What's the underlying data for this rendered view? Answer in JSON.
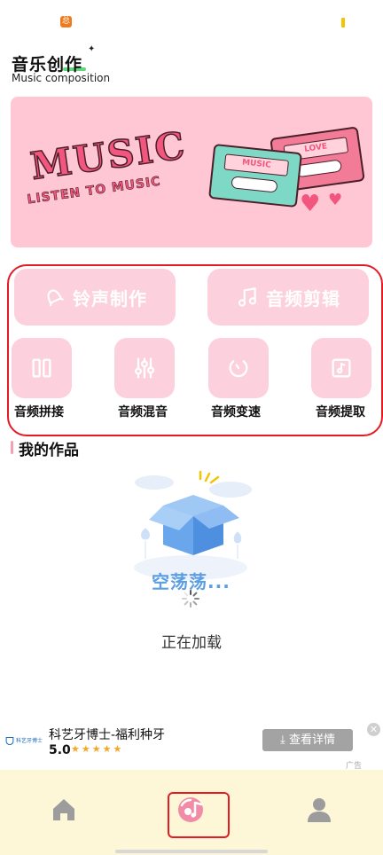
{
  "status_bar": {
    "app_icon_label": "总"
  },
  "header": {
    "title": "音乐创作",
    "subtitle": "Music composition"
  },
  "banner": {
    "headline": "MUSIC",
    "tagline": "LISTEN TO MUSIC",
    "cassette_front_label": "MUSIC",
    "cassette_back_label": "LOVE"
  },
  "features": {
    "ringtone": "铃声制作",
    "audio_cut": "音频剪辑",
    "tools": [
      {
        "label": "音频拼接",
        "icon": "pause-bars-icon"
      },
      {
        "label": "音频混音",
        "icon": "sliders-icon"
      },
      {
        "label": "音频变速",
        "icon": "speed-dial-icon"
      },
      {
        "label": "音频提取",
        "icon": "music-file-icon"
      }
    ]
  },
  "works": {
    "title": "我的作品",
    "empty_text": "空荡荡...",
    "loading_text": "正在加载"
  },
  "ad": {
    "logo_text": "科艺牙博士",
    "title": "科艺牙博士-福利种牙",
    "rating": "5.0",
    "stars": "★★★★★",
    "cta": "查看详情",
    "tag": "广告"
  },
  "tabbar": {
    "items": [
      {
        "icon": "home-icon"
      },
      {
        "icon": "music-disc-icon",
        "active": true
      },
      {
        "icon": "person-icon"
      }
    ]
  },
  "colors": {
    "accent_pink": "#fdd0dd",
    "banner_bg": "#ffc7d3",
    "highlight_red": "#e31b25",
    "tabbar_bg": "#fdf7d8",
    "empty_text_blue": "#5b9ee3"
  }
}
